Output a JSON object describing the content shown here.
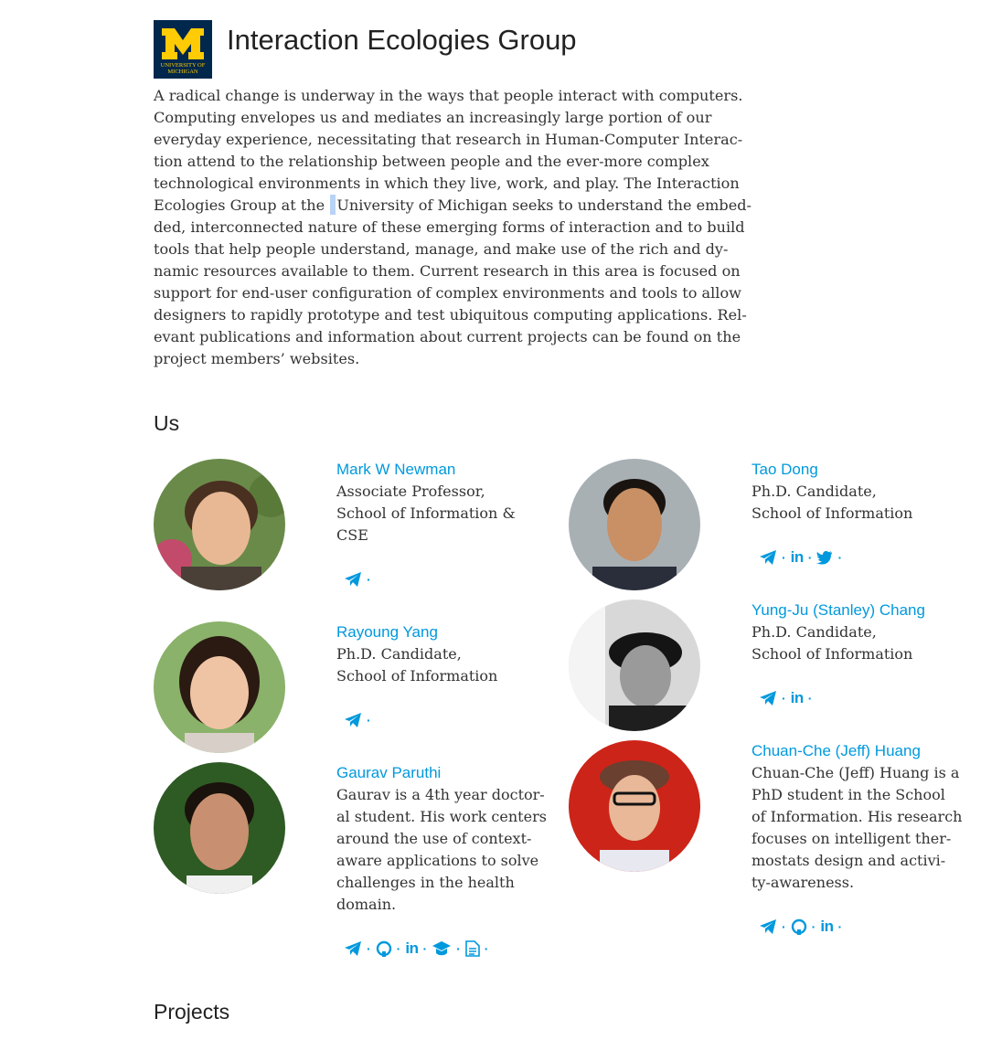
{
  "header": {
    "logo_letter": "M",
    "logo_line1": "UNIVERSITY OF",
    "logo_line2": "MICHIGAN",
    "title": "Interaction Ecologies Group"
  },
  "intro": {
    "lines": [
      "A radical change is underway in the ways that people interact with computers.",
      "Computing envelopes us and mediates an increasingly large portion of our",
      "everyday experience, necessitating that research in Human-Computer Interac-",
      "tion attend to the relationship between people and the ever-more complex",
      "technological environments in which they live, work, and play. The Interaction",
      "Ecologies Group at the",
      "University of Michigan seeks to understand the embed-",
      "ded, interconnected nature of these emerging forms of interaction and to build",
      "tools that help people understand, manage, and make use of the rich and dy-",
      "namic resources available to them. Current research in this area is focused on",
      "support for end-user configuration of complex environments and tools to allow",
      "designers to rapidly prototype and test ubiquitous computing applications. Rel-",
      "evant publications and information about current projects can be found on the",
      "project members’ websites."
    ]
  },
  "sections": {
    "us": "Us",
    "projects": "Projects"
  },
  "members": {
    "newman": {
      "name": "Mark W Newman",
      "desc": [
        "Associate Professor,",
        "School of Information &",
        "CSE"
      ],
      "links": [
        "telegram-icon"
      ]
    },
    "yang": {
      "name": "Rayoung Yang",
      "desc": [
        "Ph.D. Candidate,",
        "School of Information"
      ],
      "links": [
        "telegram-icon"
      ]
    },
    "paruthi": {
      "name": "Gaurav Paruthi",
      "desc": [
        "Gaurav is a 4th year doctor-",
        "al student. His work centers",
        "around the use of context-",
        "aware applications to solve",
        "challenges in the health",
        "domain."
      ],
      "links": [
        "telegram-icon",
        "github-icon",
        "linkedin-icon",
        "graduation-cap-icon",
        "document-icon"
      ]
    },
    "dong": {
      "name": "Tao Dong",
      "desc": [
        "Ph.D. Candidate,",
        "School of Information"
      ],
      "links": [
        "telegram-icon",
        "linkedin-icon",
        "twitter-icon"
      ]
    },
    "chang": {
      "name": "Yung-Ju (Stanley) Chang",
      "desc": [
        "Ph.D. Candidate,",
        "School of Information"
      ],
      "links": [
        "telegram-icon",
        "linkedin-icon"
      ]
    },
    "huang": {
      "name": "Chuan-Che (Jeff) Huang",
      "desc": [
        "Chuan-Che (Jeff) Huang is a",
        "PhD student in the School",
        "of Information. His research",
        "focuses on intelligent ther-",
        "mostats design and activi-",
        "ty-awareness."
      ],
      "links": [
        "telegram-icon",
        "github-icon",
        "linkedin-icon"
      ]
    }
  },
  "link_labels": {
    "linkedin": "in",
    "separator": "·"
  },
  "colors": {
    "accent": "#0099DD",
    "michigan_blue": "#00274C",
    "michigan_maize": "#FFCB05"
  }
}
